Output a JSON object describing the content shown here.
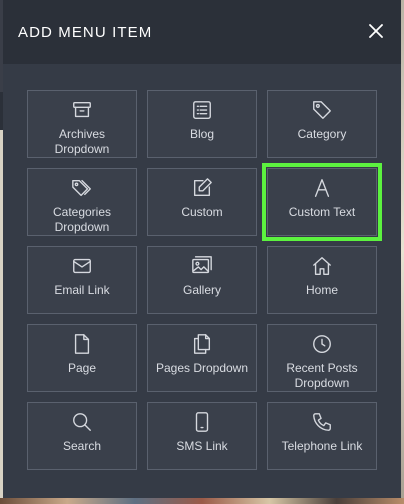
{
  "modal": {
    "title": "ADD MENU ITEM"
  },
  "items": [
    {
      "label": "Archives\nDropdown",
      "icon": "archive-icon"
    },
    {
      "label": "Blog",
      "icon": "list-icon"
    },
    {
      "label": "Category",
      "icon": "tag-icon"
    },
    {
      "label": "Categories\nDropdown",
      "icon": "tags-icon"
    },
    {
      "label": "Custom",
      "icon": "edit-icon"
    },
    {
      "label": "Custom Text",
      "icon": "font-icon"
    },
    {
      "label": "Email Link",
      "icon": "envelope-icon"
    },
    {
      "label": "Gallery",
      "icon": "images-icon"
    },
    {
      "label": "Home",
      "icon": "home-icon"
    },
    {
      "label": "Page",
      "icon": "file-icon"
    },
    {
      "label": "Pages Dropdown",
      "icon": "files-icon"
    },
    {
      "label": "Recent Posts\nDropdown",
      "icon": "clock-icon"
    },
    {
      "label": "Search",
      "icon": "search-icon"
    },
    {
      "label": "SMS Link",
      "icon": "mobile-icon"
    },
    {
      "label": "Telephone Link",
      "icon": "phone-icon"
    }
  ],
  "selected_item": "Custom Text",
  "colors": {
    "highlight": "#5cf23f",
    "modal_bg": "#353b46",
    "header_bg": "#2b3039"
  }
}
